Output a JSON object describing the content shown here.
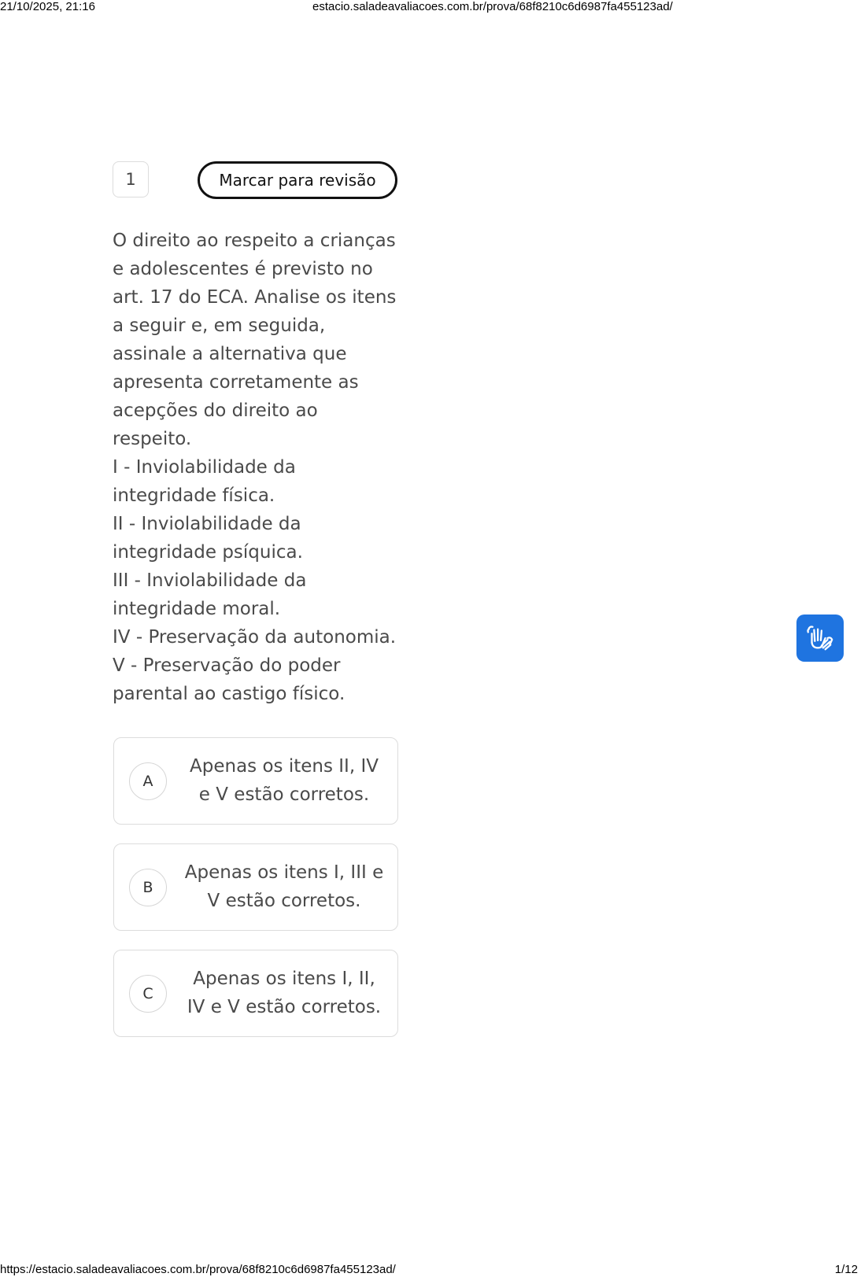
{
  "print_header": {
    "datetime": "21/10/2025, 21:16",
    "page_title": "estacio.saladeavaliacoes.com.br/prova/68f8210c6d6987fa455123ad/"
  },
  "print_footer": {
    "url": "https://estacio.saladeavaliacoes.com.br/prova/68f8210c6d6987fa455123ad/",
    "page_count": "1/12"
  },
  "question": {
    "number": "1",
    "review_label": "Marcar para revisão",
    "text": "O direito ao respeito a crianças\ne adolescentes é previsto no\nart. 17 do ECA. Analise os itens\na seguir e, em seguida,\nassinale a alternativa que\napresenta corretamente as\nacepções do direito ao\nrespeito.\nI - Inviolabilidade da\nintegridade física.\nII - Inviolabilidade da\nintegridade psíquica.\nIII - Inviolabilidade da\nintegridade moral.\nIV - Preservação da autonomia.\nV - Preservação do poder\nparental ao castigo físico."
  },
  "options": [
    {
      "letter": "A",
      "text": "Apenas os itens II, IV e V estão corretos."
    },
    {
      "letter": "B",
      "text": "Apenas os itens I, III e V estão corretos."
    },
    {
      "letter": "C",
      "text": "Apenas os itens I, II, IV e V estão corretos."
    }
  ],
  "accessibility": {
    "icon": "sign-language-icon",
    "color": "#1f74e0"
  }
}
